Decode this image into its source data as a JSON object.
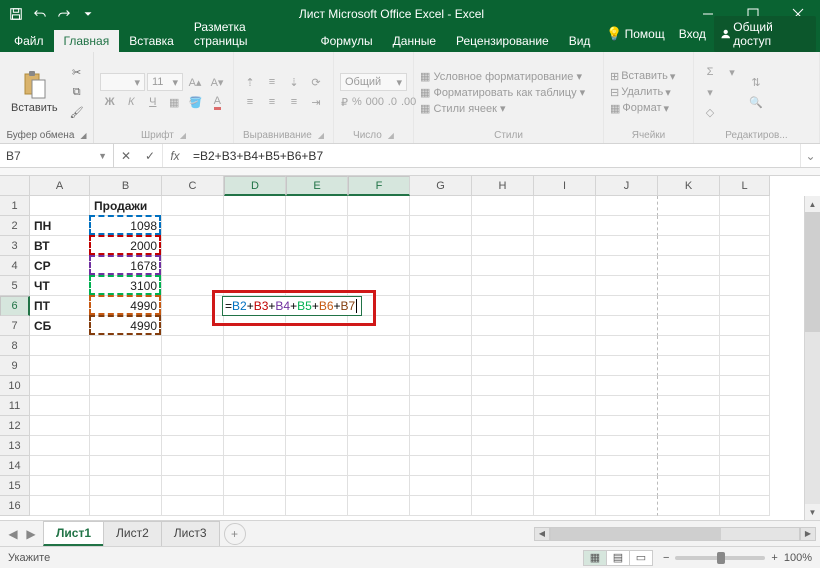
{
  "title": "Лист Microsoft Office Excel - Excel",
  "tabs": {
    "file": "Файл",
    "home": "Главная",
    "insert": "Вставка",
    "pageLayout": "Разметка страницы",
    "formulas": "Формулы",
    "data": "Данные",
    "review": "Рецензирование",
    "view": "Вид",
    "help": "Помощ",
    "login": "Вход",
    "share": "Общий доступ"
  },
  "groups": {
    "clipboard": "Буфер обмена",
    "font": "Шрифт",
    "alignment": "Выравнивание",
    "number": "Число",
    "styles": "Стили",
    "cells": "Ячейки",
    "editing": "Редактиров..."
  },
  "ribbon": {
    "paste": "Вставить",
    "fontSize": "11",
    "numberFormat": "Общий",
    "condFormat": "Условное форматирование",
    "formatTable": "Форматировать как таблицу",
    "cellStyles": "Стили ячеек",
    "insert2": "Вставить",
    "delete": "Удалить",
    "format": "Формат"
  },
  "nameBox": "B7",
  "formula": "=B2+B3+B4+B5+B6+B7",
  "formulaTokens": [
    "=",
    "B2",
    "+",
    "B3",
    "+",
    "B4",
    "+",
    "B5",
    "+",
    "B6",
    "+",
    "B7"
  ],
  "cols": [
    "A",
    "B",
    "C",
    "D",
    "E",
    "F",
    "G",
    "H",
    "I",
    "J",
    "K",
    "L"
  ],
  "rowCount": 16,
  "data": {
    "B1": "Продажи",
    "A2": "ПН",
    "B2": "1098",
    "A3": "ВТ",
    "B3": "2000",
    "A4": "СР",
    "B4": "1678",
    "A5": "ЧТ",
    "B5": "3100",
    "A6": "ПТ",
    "B6": "4990",
    "A7": "СБ",
    "B7": "4990"
  },
  "refColors": [
    "#0070c0",
    "#c00000",
    "#7030a0",
    "#00b050",
    "#c65911",
    "#833c0c"
  ],
  "sheets": [
    "Лист1",
    "Лист2",
    "Лист3"
  ],
  "status": "Укажите",
  "zoom": "100%"
}
